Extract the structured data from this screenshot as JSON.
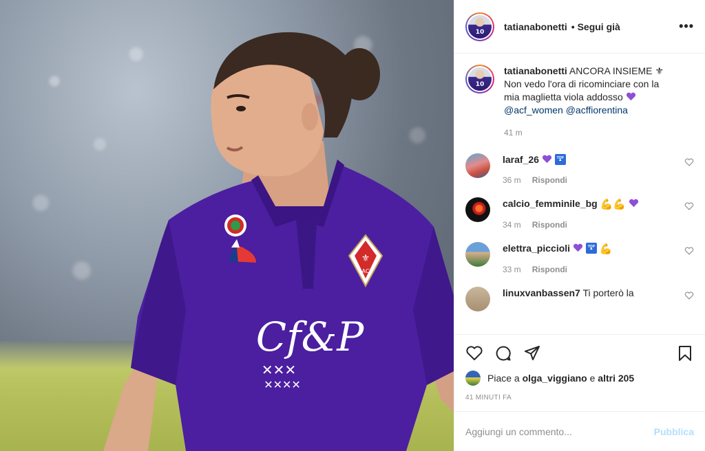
{
  "header": {
    "username": "tatianabonetti",
    "follow_label": "• Segui già",
    "more": "•••"
  },
  "caption": {
    "username": "tatianabonetti",
    "line1": "ANCORA INSIEME ⚜",
    "line2": "Non vedo l'ora di ricominciare con la",
    "line3": "mia maglietta viola addosso",
    "mention1": "@acf_women",
    "mention2": "@acffiorentina",
    "time": "41 m"
  },
  "comments": [
    {
      "username": "laraf_26",
      "time": "36 m",
      "reply": "Rispondi"
    },
    {
      "username": "calcio_femminile_bg",
      "time": "34 m",
      "reply": "Rispondi",
      "arms": "💪💪"
    },
    {
      "username": "elettra_piccioli",
      "time": "33 m",
      "reply": "Rispondi",
      "arms": "💪"
    },
    {
      "username": "linuxvanbassen7",
      "text": "Ti porterò la"
    }
  ],
  "likes": {
    "prefix": "Piace a",
    "user": "olga_viggiano",
    "middle": "e",
    "others": "altri 205"
  },
  "ago": "41 MINUTI FA",
  "add_comment": {
    "placeholder": "Aggiungi un commento...",
    "post_label": "Pubblica"
  },
  "colors": {
    "jersey": "#4b1fa0",
    "link": "#00376b",
    "post_disabled": "#b2dffc",
    "heart_purple": "#8e4fd6"
  }
}
